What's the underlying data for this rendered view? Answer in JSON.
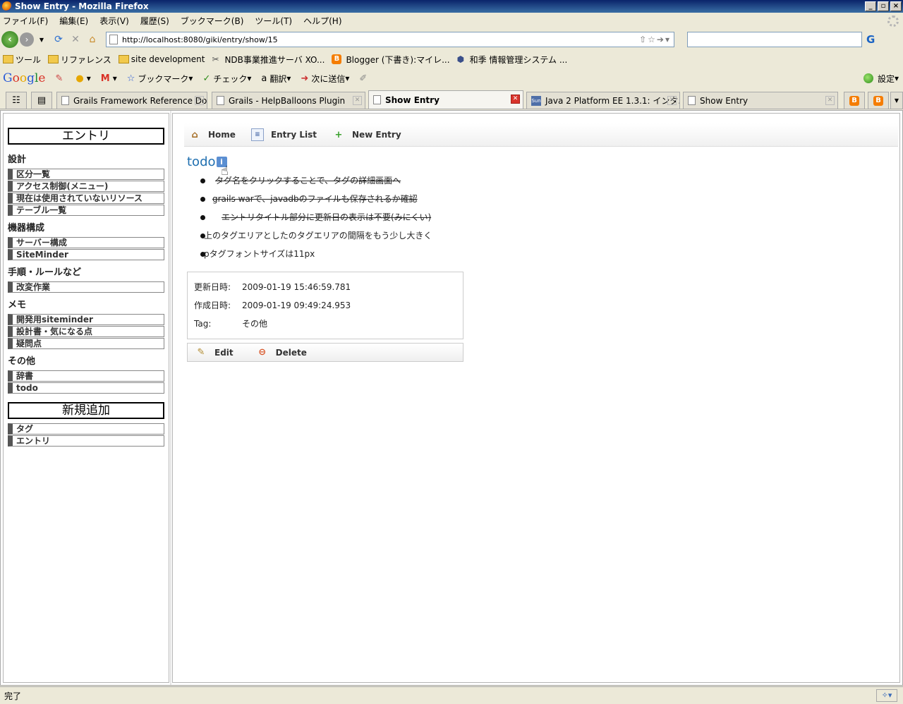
{
  "window": {
    "title": "Show Entry - Mozilla Firefox"
  },
  "menu": [
    "ファイル(F)",
    "編集(E)",
    "表示(V)",
    "履歴(S)",
    "ブックマーク(B)",
    "ツール(T)",
    "ヘルプ(H)"
  ],
  "nav": {
    "url": "http://localhost:8080/giki/entry/show/15",
    "search_value": ""
  },
  "bookmarks": [
    {
      "label": "ツール",
      "icon": "folder-icon"
    },
    {
      "label": "リファレンス",
      "icon": "folder-icon"
    },
    {
      "label": "site development",
      "icon": "folder-icon"
    },
    {
      "label": "NDB事業推進サーバ XO...",
      "icon": "tool-icon"
    },
    {
      "label": "Blogger (下書き):マイレ...",
      "icon": "blogger-icon"
    },
    {
      "label": "和季 情報管理システム ...",
      "icon": "system-icon"
    }
  ],
  "google_toolbar": {
    "logo": "Google",
    "bookmarks_label": "ブックマーク",
    "check_label": "チェック",
    "translate_label": "翻訳",
    "send_label": "次に送信",
    "settings_label": "設定"
  },
  "tabs": [
    {
      "label": "Grails Framework Reference Do...",
      "active": false
    },
    {
      "label": "Grails - HelpBalloons Plugin",
      "active": false
    },
    {
      "label": "Show Entry",
      "active": true
    },
    {
      "label": "Java 2 Platform EE 1.3.1: インタ...",
      "active": false
    },
    {
      "label": "Show Entry",
      "active": false
    }
  ],
  "sidebar": {
    "entry_heading": "エントリ",
    "categories": [
      {
        "name": "設計",
        "links": [
          "区分一覧",
          "アクセス制御(メニュー)",
          "現在は使用されていないリソース",
          "テーブル一覧"
        ]
      },
      {
        "name": "機器構成",
        "links": [
          "サーバー構成",
          "SiteMinder"
        ]
      },
      {
        "name": "手順・ルールなど",
        "links": [
          "改変作業"
        ]
      },
      {
        "name": "メモ",
        "links": [
          "開発用siteminder",
          "設計書・気になる点",
          "疑問点"
        ]
      },
      {
        "name": "その他",
        "links": [
          "辞書",
          "todo"
        ]
      }
    ],
    "new_heading": "新規追加",
    "new_links": [
      "タグ",
      "エントリ"
    ]
  },
  "main_menu": {
    "home": "Home",
    "list": "Entry List",
    "new": "New Entry"
  },
  "entry": {
    "title": "todo",
    "items": [
      {
        "text": "タグ名をクリックすることで、タグの詳細画面へ",
        "done": true,
        "indent": 0
      },
      {
        "text": "grails warで、javadbのファイルも保存されるか確認",
        "done": true,
        "indent": 12
      },
      {
        "text": "エントリタイトル部分に更新日の表示は不要(みにくい)",
        "done": true,
        "indent": 25
      },
      {
        "text": "上のタグエリアとしたのタグエリアの間隔をもう少し大きく",
        "done": false,
        "indent": 0
      },
      {
        "text": "pタグフォントサイズは11px",
        "done": false,
        "indent": 0
      }
    ],
    "updated_label": "更新日時:",
    "updated_value": "2009-01-19 15:46:59.781",
    "created_label": "作成日時:",
    "created_value": "2009-01-19 09:49:24.953",
    "tag_label": "Tag:",
    "tag_value": "その他",
    "edit_label": "Edit",
    "delete_label": "Delete"
  },
  "status": {
    "text": "完了"
  }
}
